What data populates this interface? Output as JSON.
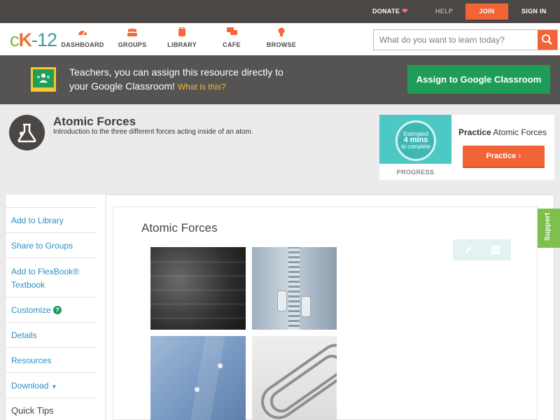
{
  "topbar": {
    "donate": "DONATE",
    "help": "HELP",
    "join": "JOIN",
    "signin": "SIGN IN"
  },
  "logo": {
    "c": "c",
    "k": "K",
    "num": "-12"
  },
  "nav": {
    "items": [
      {
        "label": "DASHBOARD",
        "icon": "dashboard-icon"
      },
      {
        "label": "GROUPS",
        "icon": "groups-icon"
      },
      {
        "label": "LIBRARY",
        "icon": "library-icon"
      },
      {
        "label": "CAFE",
        "icon": "cafe-icon"
      },
      {
        "label": "BROWSE",
        "icon": "browse-icon"
      }
    ],
    "search_placeholder": "What do you want to learn today?"
  },
  "classroom": {
    "line1": "Teachers, you can assign this resource directly to",
    "line2": "your Google Classroom!",
    "what": "What is this?",
    "button": "Assign to Google Classroom"
  },
  "header": {
    "title": "Atomic Forces",
    "subtitle": "Introduction to the three different forces acting inside of an atom."
  },
  "progress": {
    "estimated": "Estimated",
    "mins": "4 mins",
    "complete": "to complete",
    "label": "PROGRESS",
    "practice_bold": "Practice",
    "practice_rest": " Atomic Forces",
    "practice_button": "Practice"
  },
  "sidebar": {
    "items": [
      {
        "label": "Add to Library"
      },
      {
        "label": "Share to Groups"
      },
      {
        "label": "Add to FlexBook®",
        "label2": "Textbook"
      },
      {
        "label": "Customize"
      },
      {
        "label": "Details"
      },
      {
        "label": "Resources"
      },
      {
        "label": "Download"
      },
      {
        "label": "Quick Tips"
      }
    ],
    "customize_help": "?"
  },
  "content": {
    "title": "Atomic Forces"
  },
  "support": "Support",
  "colors": {
    "accent": "#f26436",
    "link": "#2d8fc6",
    "google_green": "#1f9d57"
  }
}
